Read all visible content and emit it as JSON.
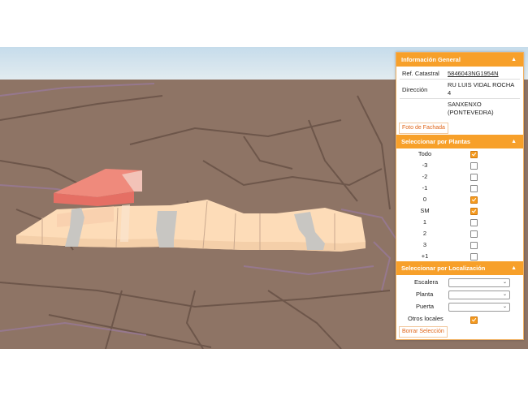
{
  "colors": {
    "accent": "#f7a02a",
    "ground": "#8c7263",
    "sky": "#cfe3ee",
    "building": "#fddcb8",
    "highlight": "#ef8a7c",
    "common": "#c8c6c2"
  },
  "info": {
    "header": "Información General",
    "ref_label": "Ref. Catastral",
    "ref_value": "5846043NG1954N",
    "dir_label": "Dirección",
    "dir_line1": "RU LUIS VIDAL ROCHA",
    "dir_line2": "4",
    "dir_line3": "SANXENXO",
    "dir_line4": "(PONTEVEDRA)",
    "photo_button": "Foto de Fachada"
  },
  "plantas": {
    "header": "Seleccionar por Plantas",
    "items": [
      {
        "label": "Todo",
        "checked": true
      },
      {
        "label": "-3",
        "checked": false
      },
      {
        "label": "-2",
        "checked": false
      },
      {
        "label": "-1",
        "checked": false
      },
      {
        "label": "0",
        "checked": true
      },
      {
        "label": "SM",
        "checked": true
      },
      {
        "label": "1",
        "checked": false
      },
      {
        "label": "2",
        "checked": false
      },
      {
        "label": "3",
        "checked": false
      },
      {
        "label": "+1",
        "checked": false
      }
    ]
  },
  "localizacion": {
    "header": "Seleccionar por Localización",
    "escalera_label": "Escalera",
    "planta_label": "Planta",
    "puerta_label": "Puerta",
    "otros_label": "Otros locales",
    "otros_checked": true,
    "clear_button": "Borrar Selección"
  },
  "icons": {
    "collapse": "triangle-up-icon",
    "dropdown": "chevron-down-icon"
  }
}
